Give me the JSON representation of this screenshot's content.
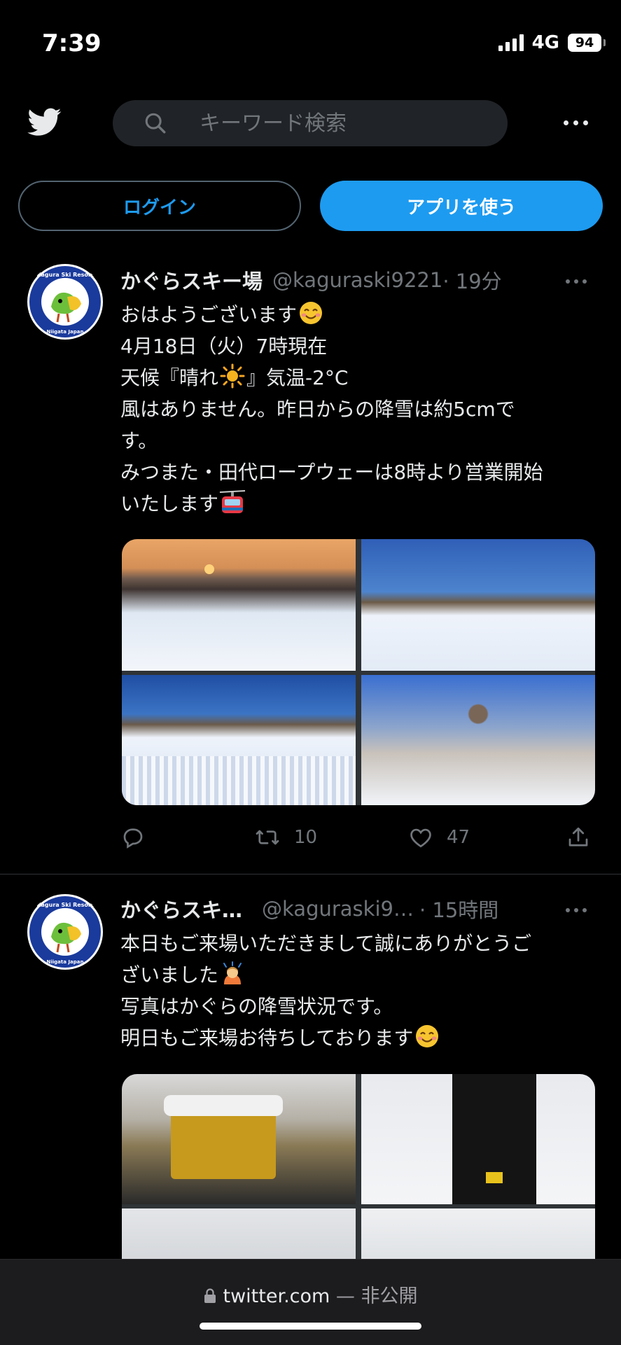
{
  "status_bar": {
    "time": "7:39",
    "network": "4G",
    "battery": "94"
  },
  "header": {
    "search_placeholder": "キーワード検索"
  },
  "auth": {
    "login_label": "ログイン",
    "app_label": "アプリを使う"
  },
  "tweets": [
    {
      "name": "かぐらスキー場",
      "handle": "@kaguraski9221",
      "time": " · 19分",
      "avatar_text": {
        "top": "Kagura Ski Resort",
        "bottom": "Niigata Japan"
      },
      "lines": [
        "おはようございます",
        "4月18日（火）7時現在",
        "天候『晴れ",
        "』気温-2°C",
        "風はありません。昨日からの降雪は約5cmで",
        "す。",
        "みつまた・田代ロープウェーは8時より営業開始",
        "いたします"
      ],
      "reply_count": "",
      "retweet_count": "10",
      "like_count": "47"
    },
    {
      "name": "かぐらスキ…",
      "handle": "@kaguraski9…",
      "time": " · 15時間",
      "avatar_text": {
        "top": "Kagura Ski Resort",
        "bottom": "Niigata Japan"
      },
      "lines": [
        "本日もご来場いただきまして誠にありがとうご",
        "ざいました",
        "写真はかぐらの降雪状況です。",
        "明日もご来場お待ちしております"
      ]
    }
  ],
  "url_bar": {
    "domain": "twitter.com",
    "suffix": " — 非公開"
  },
  "icons": {
    "brand": "twitter-bird-icon",
    "search": "search-icon",
    "reply": "reply-icon",
    "retweet": "retweet-icon",
    "like": "heart-icon",
    "share": "share-icon",
    "lock": "lock-icon"
  },
  "colors": {
    "accent": "#1d9bf0",
    "background": "#000000",
    "text": "#e7e9ea",
    "muted": "#71767b"
  }
}
